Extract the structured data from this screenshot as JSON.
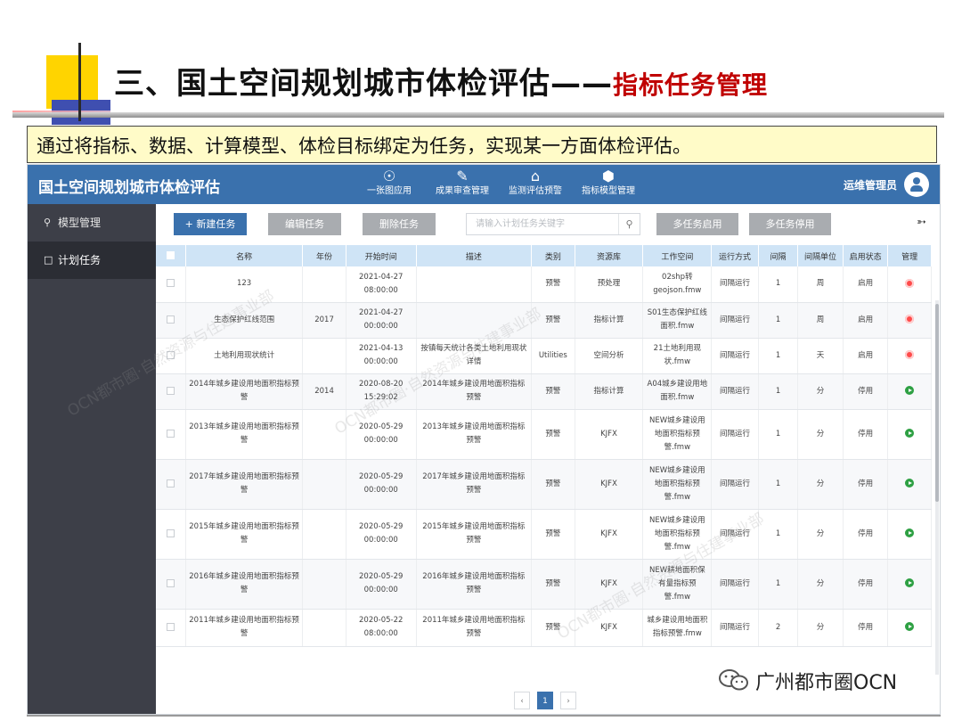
{
  "slide": {
    "title_main": "三、国土空间规划城市体检评估——",
    "title_highlight": "指标任务管理",
    "description": "通过将指标、数据、计算模型、体检目标绑定为任务，实现某一方面体检评估。",
    "watermark_brand": "广州都市圈OCN",
    "watermark_texts": [
      "OCN都市圈·自然资源与住建事业部",
      "OCN都市圈·自然资源与住建事业部",
      "OCN都市圈·自然资源与住建事业部"
    ]
  },
  "app": {
    "title": "国土空间规划城市体检评估",
    "nav": [
      {
        "label": "一张图应用",
        "icon": "compass-icon"
      },
      {
        "label": "成果审查管理",
        "icon": "review-icon"
      },
      {
        "label": "监测评估预警",
        "icon": "monitor-chart-icon"
      },
      {
        "label": "指标模型管理",
        "icon": "cube-icon"
      }
    ],
    "user": "运维管理员",
    "accent_color": "#3a71ad"
  },
  "sidebar": {
    "items": [
      {
        "label": "模型管理",
        "icon": "search-key-icon",
        "active": false
      },
      {
        "label": "计划任务",
        "icon": "document-icon",
        "active": true
      }
    ]
  },
  "toolbar": {
    "new_task": "+ 新建任务",
    "edit_task": "编辑任务",
    "delete_task": "删除任务",
    "search_placeholder": "请输入计划任务关键字",
    "multi_start": "多任务启用",
    "multi_stop": "多任务停用"
  },
  "table": {
    "headers": [
      "",
      "名称",
      "年份",
      "开始时间",
      "描述",
      "类别",
      "资源库",
      "工作空间",
      "运行方式",
      "间隔",
      "间隔单位",
      "启用状态",
      "管理"
    ],
    "rows": [
      {
        "name": "123",
        "year": "",
        "start": "2021-04-27 08:00:00",
        "desc": "",
        "category": "预警",
        "lib": "预处理",
        "workspace": "02shp转geojson.fmw",
        "mode": "间隔运行",
        "interval": "1",
        "unit": "周",
        "status": "启用",
        "action": "stop"
      },
      {
        "name": "生态保护红线范围",
        "year": "2017",
        "start": "2021-04-27 00:00:00",
        "desc": "",
        "category": "预警",
        "lib": "指标计算",
        "workspace": "S01生态保护红线面积.fmw",
        "mode": "间隔运行",
        "interval": "1",
        "unit": "周",
        "status": "启用",
        "action": "stop"
      },
      {
        "name": "土地利用现状统计",
        "year": "",
        "start": "2021-04-13 00:00:00",
        "desc": "按镇每天统计各类土地利用现状详情",
        "category": "Utilities",
        "lib": "空间分析",
        "workspace": "21土地利用现状.fmw",
        "mode": "间隔运行",
        "interval": "1",
        "unit": "天",
        "status": "启用",
        "action": "stop"
      },
      {
        "name": "2014年城乡建设用地面积指标预警",
        "year": "2014",
        "start": "2020-08-20 15:29:02",
        "desc": "2014年城乡建设用地面积指标预警",
        "category": "预警",
        "lib": "指标计算",
        "workspace": "A04城乡建设用地面积.fmw",
        "mode": "间隔运行",
        "interval": "1",
        "unit": "分",
        "status": "停用",
        "action": "play"
      },
      {
        "name": "2013年城乡建设用地面积指标预警",
        "year": "",
        "start": "2020-05-29 00:00:00",
        "desc": "2013年城乡建设用地面积指标预警",
        "category": "预警",
        "lib": "KJFX",
        "workspace": "NEW城乡建设用地面积指标预警.fmw",
        "mode": "间隔运行",
        "interval": "1",
        "unit": "分",
        "status": "停用",
        "action": "play"
      },
      {
        "name": "2017年城乡建设用地面积指标预警",
        "year": "",
        "start": "2020-05-29 00:00:00",
        "desc": "2017年城乡建设用地面积指标预警",
        "category": "预警",
        "lib": "KJFX",
        "workspace": "NEW城乡建设用地面积指标预警.fmw",
        "mode": "间隔运行",
        "interval": "1",
        "unit": "分",
        "status": "停用",
        "action": "play"
      },
      {
        "name": "2015年城乡建设用地面积指标预警",
        "year": "",
        "start": "2020-05-29 00:00:00",
        "desc": "2015年城乡建设用地面积指标预警",
        "category": "预警",
        "lib": "KJFX",
        "workspace": "NEW城乡建设用地面积指标预警.fmw",
        "mode": "间隔运行",
        "interval": "1",
        "unit": "分",
        "status": "停用",
        "action": "play"
      },
      {
        "name": "2016年城乡建设用地面积指标预警",
        "year": "",
        "start": "2020-05-29 00:00:00",
        "desc": "2016年城乡建设用地面积指标预警",
        "category": "预警",
        "lib": "KJFX",
        "workspace": "NEW耕地面积保有量指标预警.fmw",
        "mode": "间隔运行",
        "interval": "1",
        "unit": "分",
        "status": "停用",
        "action": "play"
      },
      {
        "name": "2011年城乡建设用地面积指标预警",
        "year": "",
        "start": "2020-05-22 08:00:00",
        "desc": "2011年城乡建设用地面积指标预警",
        "category": "预警",
        "lib": "KJFX",
        "workspace": "城乡建设用地面积指标预警.fmw",
        "mode": "间隔运行",
        "interval": "2",
        "unit": "分",
        "status": "停用",
        "action": "play"
      }
    ]
  },
  "pager": {
    "prev": "‹",
    "current": "1",
    "next": "›"
  }
}
